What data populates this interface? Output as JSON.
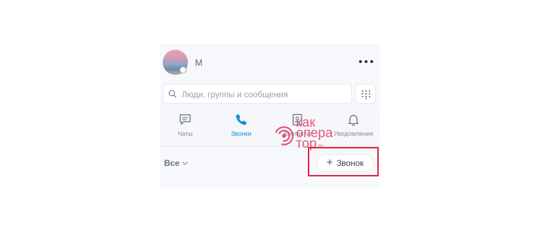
{
  "user": {
    "name": "М"
  },
  "search": {
    "placeholder": "Люди, группы и сообщения"
  },
  "tabs": [
    {
      "label": "Чаты",
      "icon": "chat-icon",
      "active": false
    },
    {
      "label": "Звонки",
      "icon": "phone-icon",
      "active": true
    },
    {
      "label": "Контакты",
      "icon": "contacts-icon",
      "active": false
    },
    {
      "label": "Уведомления",
      "icon": "bell-icon",
      "active": false
    }
  ],
  "filter": {
    "label": "Все"
  },
  "call_button": {
    "plus": "+",
    "label": "Звонок"
  },
  "watermark": {
    "line1": "как",
    "line2": "опера",
    "line3": "тор",
    "suffix": ".ru"
  },
  "colors": {
    "accent": "#1b8fd6",
    "highlight": "#e2213a",
    "watermark": "#e43a63"
  }
}
